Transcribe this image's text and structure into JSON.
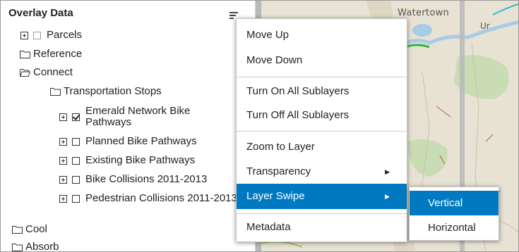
{
  "panel": {
    "title": "Overlay Data",
    "layers": [
      {
        "label": "Parcels",
        "expander": true,
        "checkbox": "unchecked-grey"
      },
      {
        "label": "Reference",
        "icon": "folder-closed-icon"
      },
      {
        "label": "Connect",
        "icon": "folder-open-icon"
      },
      {
        "label": "Transportation Stops",
        "icon": "folder-closed-icon"
      },
      {
        "label": "Emerald Network Bike Pathways",
        "expander": true,
        "checkbox": "checked"
      },
      {
        "label": "Planned Bike Pathways",
        "expander": true,
        "checkbox": "unchecked"
      },
      {
        "label": "Existing Bike Pathways",
        "expander": true,
        "checkbox": "unchecked"
      },
      {
        "label": "Bike Collisions 2011-2013",
        "expander": true,
        "checkbox": "unchecked"
      },
      {
        "label": "Pedestrian Collisions 2011-2013",
        "expander": true,
        "checkbox": "unchecked"
      },
      {
        "label": "Cool",
        "icon": "folder-closed-icon"
      },
      {
        "label": "Absorb",
        "icon": "folder-closed-icon"
      }
    ]
  },
  "context_menu": {
    "items": [
      "Move Up",
      "Move Down",
      "Turn On All Sublayers",
      "Turn Off All Sublayers",
      "Zoom to Layer",
      "Transparency",
      "Layer Swipe",
      "Metadata"
    ],
    "highlighted": "Layer Swipe"
  },
  "submenu": {
    "items": [
      "Vertical",
      "Horizontal"
    ],
    "highlighted": "Vertical"
  },
  "map": {
    "labels": [
      "Watertown",
      "Ur"
    ]
  },
  "colors": {
    "accent": "#0079c1",
    "map_background": "#e7e2d3",
    "water": "#a8cbe6",
    "park": "#c9dcb3"
  }
}
